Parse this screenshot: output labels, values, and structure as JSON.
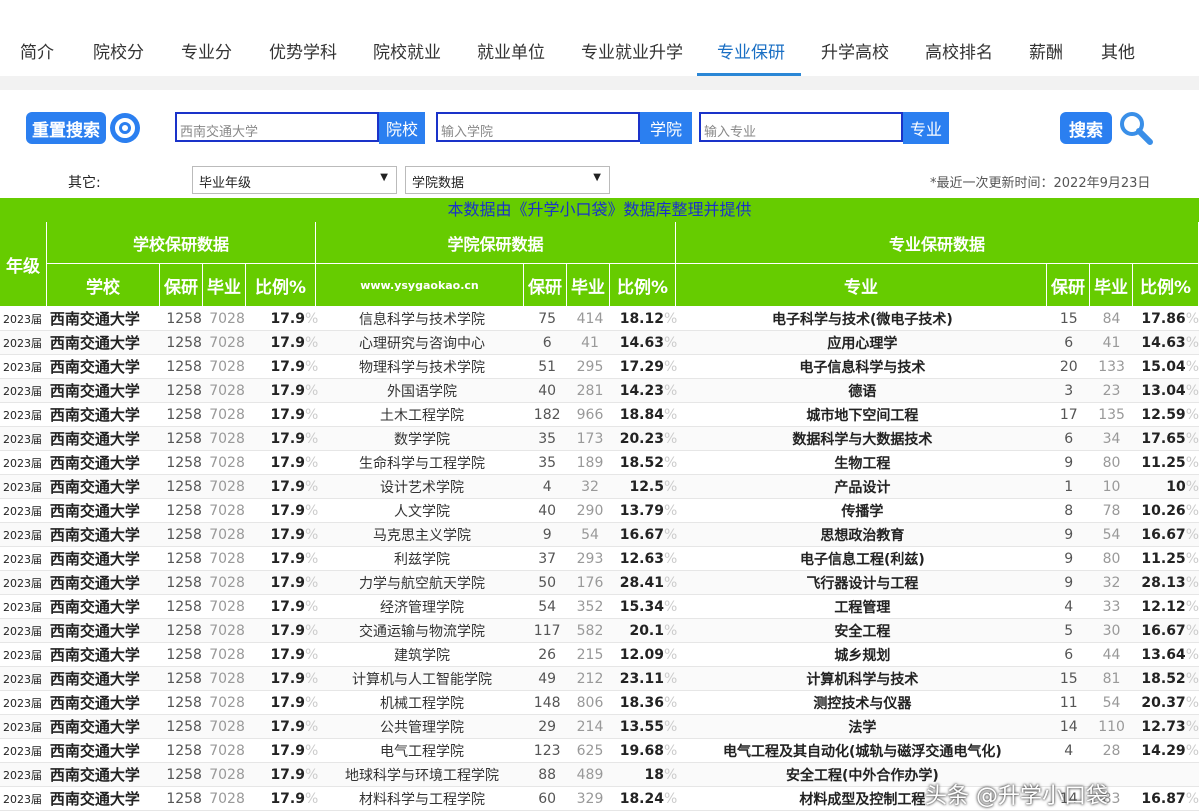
{
  "nav": {
    "items": [
      "简介",
      "院校分",
      "专业分",
      "优势学科",
      "院校就业",
      "就业单位",
      "专业就业升学",
      "专业保研",
      "升学高校",
      "高校排名",
      "薪酬",
      "其他"
    ],
    "active": "专业保研"
  },
  "search": {
    "reset_label": "重置搜索",
    "school_value": "西南交通大学",
    "school_btn": "院校",
    "college_placeholder": "输入学院",
    "college_btn": "学院",
    "major_placeholder": "输入专业",
    "major_btn": "专业",
    "search_label": "搜索"
  },
  "filters": {
    "other_label": "其它:",
    "select1": "毕业年级",
    "select2": "学院数据",
    "update_time": "*最近一次更新时间：2022年9月23日"
  },
  "banner": "本数据由《升学小口袋》数据库整理并提供",
  "headers": {
    "grade": "年级",
    "school_group": "学校保研数据",
    "college_group": "学院保研数据",
    "major_group": "专业保研数据",
    "school": "学校",
    "baoyan": "保研",
    "biye": "毕业",
    "ratio": "比例%",
    "site": "www.ysygaokao.cn",
    "major": "专业"
  },
  "rows": [
    {
      "grade": "2023届",
      "school": "西南交通大学",
      "s_by": "1258",
      "s_total": "7028",
      "s_ratio": "17.9",
      "dept": "信息科学与技术学院",
      "d_by": "75",
      "d_total": "414",
      "d_ratio": "18.12",
      "major": "电子科学与技术(微电子技术)",
      "m_by": "15",
      "m_total": "84",
      "m_ratio": "17.86"
    },
    {
      "grade": "2023届",
      "school": "西南交通大学",
      "s_by": "1258",
      "s_total": "7028",
      "s_ratio": "17.9",
      "dept": "心理研究与咨询中心",
      "d_by": "6",
      "d_total": "41",
      "d_ratio": "14.63",
      "major": "应用心理学",
      "m_by": "6",
      "m_total": "41",
      "m_ratio": "14.63"
    },
    {
      "grade": "2023届",
      "school": "西南交通大学",
      "s_by": "1258",
      "s_total": "7028",
      "s_ratio": "17.9",
      "dept": "物理科学与技术学院",
      "d_by": "51",
      "d_total": "295",
      "d_ratio": "17.29",
      "major": "电子信息科学与技术",
      "m_by": "20",
      "m_total": "133",
      "m_ratio": "15.04"
    },
    {
      "grade": "2023届",
      "school": "西南交通大学",
      "s_by": "1258",
      "s_total": "7028",
      "s_ratio": "17.9",
      "dept": "外国语学院",
      "d_by": "40",
      "d_total": "281",
      "d_ratio": "14.23",
      "major": "德语",
      "m_by": "3",
      "m_total": "23",
      "m_ratio": "13.04"
    },
    {
      "grade": "2023届",
      "school": "西南交通大学",
      "s_by": "1258",
      "s_total": "7028",
      "s_ratio": "17.9",
      "dept": "土木工程学院",
      "d_by": "182",
      "d_total": "966",
      "d_ratio": "18.84",
      "major": "城市地下空间工程",
      "m_by": "17",
      "m_total": "135",
      "m_ratio": "12.59"
    },
    {
      "grade": "2023届",
      "school": "西南交通大学",
      "s_by": "1258",
      "s_total": "7028",
      "s_ratio": "17.9",
      "dept": "数学学院",
      "d_by": "35",
      "d_total": "173",
      "d_ratio": "20.23",
      "major": "数据科学与大数据技术",
      "m_by": "6",
      "m_total": "34",
      "m_ratio": "17.65"
    },
    {
      "grade": "2023届",
      "school": "西南交通大学",
      "s_by": "1258",
      "s_total": "7028",
      "s_ratio": "17.9",
      "dept": "生命科学与工程学院",
      "d_by": "35",
      "d_total": "189",
      "d_ratio": "18.52",
      "major": "生物工程",
      "m_by": "9",
      "m_total": "80",
      "m_ratio": "11.25"
    },
    {
      "grade": "2023届",
      "school": "西南交通大学",
      "s_by": "1258",
      "s_total": "7028",
      "s_ratio": "17.9",
      "dept": "设计艺术学院",
      "d_by": "4",
      "d_total": "32",
      "d_ratio": "12.5",
      "major": "产品设计",
      "m_by": "1",
      "m_total": "10",
      "m_ratio": "10"
    },
    {
      "grade": "2023届",
      "school": "西南交通大学",
      "s_by": "1258",
      "s_total": "7028",
      "s_ratio": "17.9",
      "dept": "人文学院",
      "d_by": "40",
      "d_total": "290",
      "d_ratio": "13.79",
      "major": "传播学",
      "m_by": "8",
      "m_total": "78",
      "m_ratio": "10.26"
    },
    {
      "grade": "2023届",
      "school": "西南交通大学",
      "s_by": "1258",
      "s_total": "7028",
      "s_ratio": "17.9",
      "dept": "马克思主义学院",
      "d_by": "9",
      "d_total": "54",
      "d_ratio": "16.67",
      "major": "思想政治教育",
      "m_by": "9",
      "m_total": "54",
      "m_ratio": "16.67"
    },
    {
      "grade": "2023届",
      "school": "西南交通大学",
      "s_by": "1258",
      "s_total": "7028",
      "s_ratio": "17.9",
      "dept": "利兹学院",
      "d_by": "37",
      "d_total": "293",
      "d_ratio": "12.63",
      "major": "电子信息工程(利兹)",
      "m_by": "9",
      "m_total": "80",
      "m_ratio": "11.25"
    },
    {
      "grade": "2023届",
      "school": "西南交通大学",
      "s_by": "1258",
      "s_total": "7028",
      "s_ratio": "17.9",
      "dept": "力学与航空航天学院",
      "d_by": "50",
      "d_total": "176",
      "d_ratio": "28.41",
      "major": "飞行器设计与工程",
      "m_by": "9",
      "m_total": "32",
      "m_ratio": "28.13"
    },
    {
      "grade": "2023届",
      "school": "西南交通大学",
      "s_by": "1258",
      "s_total": "7028",
      "s_ratio": "17.9",
      "dept": "经济管理学院",
      "d_by": "54",
      "d_total": "352",
      "d_ratio": "15.34",
      "major": "工程管理",
      "m_by": "4",
      "m_total": "33",
      "m_ratio": "12.12"
    },
    {
      "grade": "2023届",
      "school": "西南交通大学",
      "s_by": "1258",
      "s_total": "7028",
      "s_ratio": "17.9",
      "dept": "交通运输与物流学院",
      "d_by": "117",
      "d_total": "582",
      "d_ratio": "20.1",
      "major": "安全工程",
      "m_by": "5",
      "m_total": "30",
      "m_ratio": "16.67"
    },
    {
      "grade": "2023届",
      "school": "西南交通大学",
      "s_by": "1258",
      "s_total": "7028",
      "s_ratio": "17.9",
      "dept": "建筑学院",
      "d_by": "26",
      "d_total": "215",
      "d_ratio": "12.09",
      "major": "城乡规划",
      "m_by": "6",
      "m_total": "44",
      "m_ratio": "13.64"
    },
    {
      "grade": "2023届",
      "school": "西南交通大学",
      "s_by": "1258",
      "s_total": "7028",
      "s_ratio": "17.9",
      "dept": "计算机与人工智能学院",
      "d_by": "49",
      "d_total": "212",
      "d_ratio": "23.11",
      "major": "计算机科学与技术",
      "m_by": "15",
      "m_total": "81",
      "m_ratio": "18.52"
    },
    {
      "grade": "2023届",
      "school": "西南交通大学",
      "s_by": "1258",
      "s_total": "7028",
      "s_ratio": "17.9",
      "dept": "机械工程学院",
      "d_by": "148",
      "d_total": "806",
      "d_ratio": "18.36",
      "major": "测控技术与仪器",
      "m_by": "11",
      "m_total": "54",
      "m_ratio": "20.37"
    },
    {
      "grade": "2023届",
      "school": "西南交通大学",
      "s_by": "1258",
      "s_total": "7028",
      "s_ratio": "17.9",
      "dept": "公共管理学院",
      "d_by": "29",
      "d_total": "214",
      "d_ratio": "13.55",
      "major": "法学",
      "m_by": "14",
      "m_total": "110",
      "m_ratio": "12.73"
    },
    {
      "grade": "2023届",
      "school": "西南交通大学",
      "s_by": "1258",
      "s_total": "7028",
      "s_ratio": "17.9",
      "dept": "电气工程学院",
      "d_by": "123",
      "d_total": "625",
      "d_ratio": "19.68",
      "major": "电气工程及其自动化(城轨与磁浮交通电气化)",
      "m_by": "4",
      "m_total": "28",
      "m_ratio": "14.29"
    },
    {
      "grade": "2023届",
      "school": "西南交通大学",
      "s_by": "1258",
      "s_total": "7028",
      "s_ratio": "17.9",
      "dept": "地球科学与环境工程学院",
      "d_by": "88",
      "d_total": "489",
      "d_ratio": "18",
      "major": "安全工程(中外合作办学)",
      "m_by": "",
      "m_total": "",
      "m_ratio": ""
    },
    {
      "grade": "2023届",
      "school": "西南交通大学",
      "s_by": "1258",
      "s_total": "7028",
      "s_ratio": "17.9",
      "dept": "材料科学与工程学院",
      "d_by": "60",
      "d_total": "329",
      "d_ratio": "18.24",
      "major": "材料成型及控制工程",
      "m_by": "14",
      "m_total": "83",
      "m_ratio": "16.87"
    }
  ],
  "watermark": "头条 @升学小口袋",
  "colors": {
    "green": "#66cc00",
    "blue": "#2b7ff0",
    "active": "#1a6fc4"
  }
}
